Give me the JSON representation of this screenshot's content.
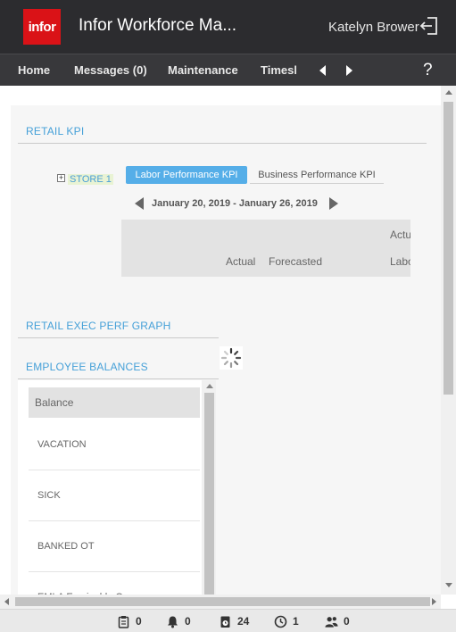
{
  "header": {
    "logo_text": "infor",
    "app_title": "Infor Workforce Ma...",
    "user_name": "Katelyn Brower"
  },
  "nav": {
    "items": [
      "Home",
      "Messages (0)",
      "Maintenance",
      "Timesh"
    ],
    "help": "?"
  },
  "retail_kpi": {
    "title": "RETAIL KPI",
    "store_label": "STORE 1",
    "expand_symbol": "+",
    "tabs": [
      "Labor Performance KPI",
      "Business Performance KPI"
    ],
    "active_tab": "Labor Performance KPI",
    "date_range": "January 20, 2019 - January 26, 2019",
    "table_headers": {
      "top_right": "Actu",
      "actual": "Actual",
      "forecasted": "Forecasted",
      "bottom_right": "Labo"
    }
  },
  "exec_graph": {
    "title": "RETAIL EXEC PERF GRAPH"
  },
  "employee_balances": {
    "title": "EMPLOYEE BALANCES",
    "header": "Balance",
    "rows": [
      "VACATION",
      "SICK",
      "BANKED OT",
      "EMLA Eaminalde O"
    ]
  },
  "footer": {
    "tasks_count": "0",
    "notifications_count": "0",
    "timecard_count": "24",
    "clock_count": "1",
    "team_count": "0"
  },
  "colors": {
    "brand_red": "#da1217",
    "topbar": "#2c2c2f",
    "accent_blue": "#45a0d8",
    "active_tab": "#55aee8"
  }
}
